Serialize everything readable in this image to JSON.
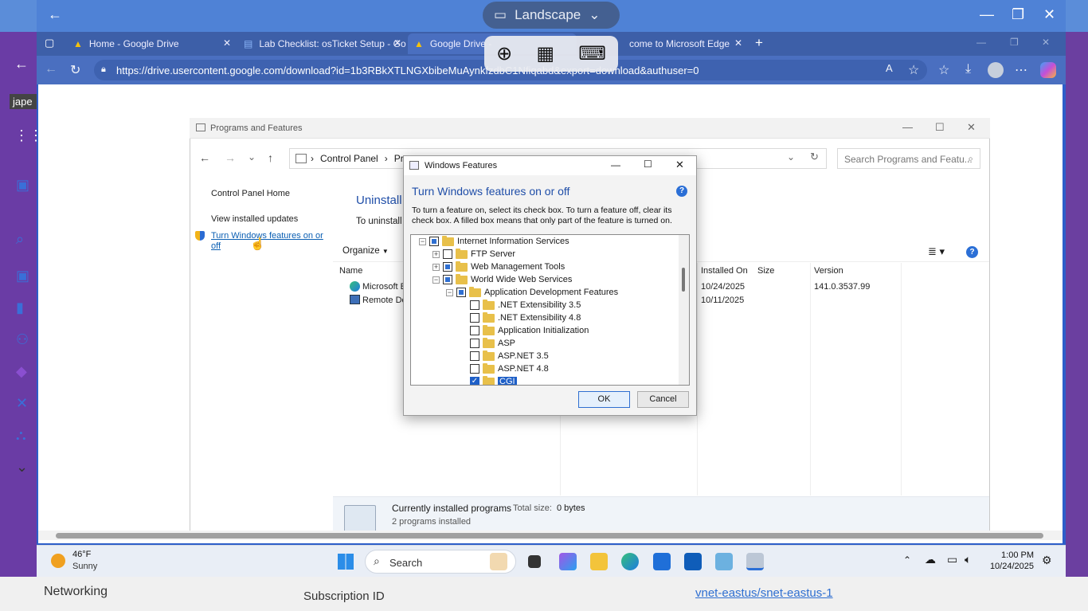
{
  "remote_bar": {
    "orientation_label": "Landscape",
    "back": "←",
    "min": "—",
    "max": "❐",
    "close": "✕"
  },
  "edge": {
    "tabs": [
      {
        "label": "Home - Google Drive"
      },
      {
        "label": "Lab Checklist: osTicket Setup - Go"
      },
      {
        "label": "Google Drive -"
      },
      {
        "label": "come to Microsoft Edge"
      }
    ],
    "new_tab": "+",
    "url": "https://drive.usercontent.google.com/download?id=1b3RBkXTLNGXbibeMuAynkfzdbC1Nfiqabd&export=download&authuser=0"
  },
  "pf": {
    "title": "Programs and Features",
    "breadcrumb": [
      "Control Panel",
      "Prog"
    ],
    "search_placeholder": "Search Programs and Featu...",
    "side": {
      "home": "Control Panel Home",
      "updates": "View installed updates",
      "features": "Turn Windows features on or off"
    },
    "heading": "Uninstall",
    "sub": "To uninstall a",
    "organize": "Organize",
    "columns": {
      "name": "Name",
      "installed_on": "Installed On",
      "size": "Size",
      "version": "Version"
    },
    "rows": [
      {
        "name": "Microsoft E",
        "installed_on": "10/24/2025",
        "size": "",
        "version": "141.0.3537.99"
      },
      {
        "name": "Remote De",
        "installed_on": "10/11/2025",
        "size": "",
        "version": ""
      }
    ],
    "status": {
      "title": "Currently installed programs",
      "total_label": "Total size:",
      "total_value": "0 bytes",
      "count": "2 programs installed"
    }
  },
  "wf": {
    "title": "Windows Features",
    "heading": "Turn Windows features on or off",
    "desc": "To turn a feature on, select its check box. To turn a feature off, clear its check box. A filled box means that only part of the feature is turned on.",
    "tree": [
      {
        "label": "Internet Information Services",
        "state": "partial",
        "exp": "−",
        "level": 0
      },
      {
        "label": "FTP Server",
        "state": "off",
        "exp": "+",
        "level": 1
      },
      {
        "label": "Web Management Tools",
        "state": "partial",
        "exp": "+",
        "level": 1
      },
      {
        "label": "World Wide Web Services",
        "state": "partial",
        "exp": "−",
        "level": 1
      },
      {
        "label": "Application Development Features",
        "state": "partial",
        "exp": "−",
        "level": 2
      },
      {
        "label": ".NET Extensibility 3.5",
        "state": "off",
        "exp": "",
        "level": 3
      },
      {
        "label": ".NET Extensibility 4.8",
        "state": "off",
        "exp": "",
        "level": 3
      },
      {
        "label": "Application Initialization",
        "state": "off",
        "exp": "",
        "level": 3
      },
      {
        "label": "ASP",
        "state": "off",
        "exp": "",
        "level": 3
      },
      {
        "label": "ASP.NET 3.5",
        "state": "off",
        "exp": "",
        "level": 3
      },
      {
        "label": "ASP.NET 4.8",
        "state": "off",
        "exp": "",
        "level": 3
      },
      {
        "label": "CGI",
        "state": "on",
        "exp": "",
        "level": 3
      }
    ],
    "ok": "OK",
    "cancel": "Cancel"
  },
  "taskbar": {
    "temp": "46°F",
    "weather": "Sunny",
    "search": "Search",
    "time": "1:00 PM",
    "date": "10/24/2025"
  },
  "underlay": {
    "left_label": "jape",
    "networking": "Networking",
    "subscription": "Subscription ID",
    "vnet": "vnet-eastus/snet-eastus-1"
  }
}
